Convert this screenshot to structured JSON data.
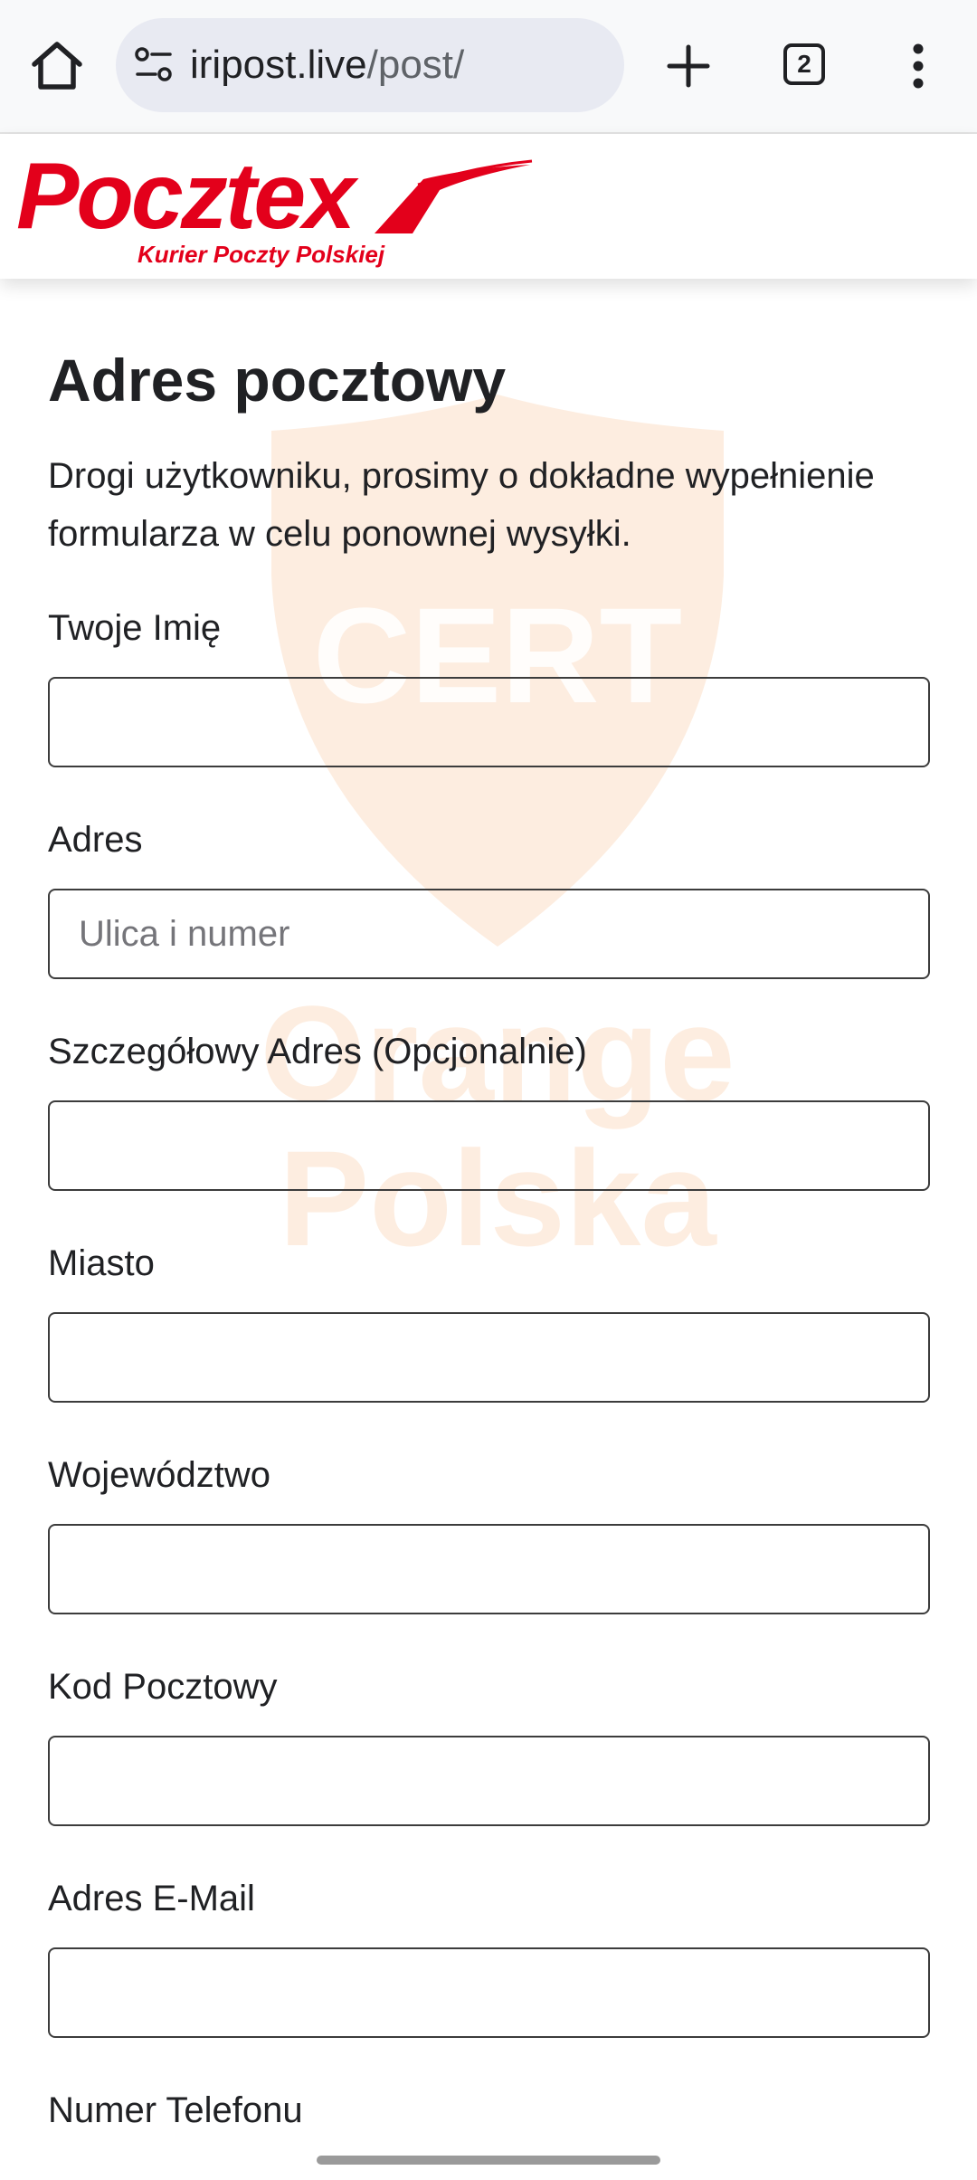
{
  "browser": {
    "url_host": "iripost.live",
    "url_path": "/post/",
    "tab_count": "2",
    "icons": [
      "home-icon",
      "site-info-icon",
      "plus-icon",
      "tabs-icon",
      "more-vert-icon"
    ]
  },
  "header": {
    "logo_text": "Pocztex",
    "logo_subtitle": "Kurier Poczty Polskiej",
    "brand_color": "#e3001b"
  },
  "watermark": {
    "line1": "CERT",
    "line2": "Orange",
    "line3": "Polska",
    "color": "#f47d20"
  },
  "form": {
    "title": "Adres pocztowy",
    "intro": "Drogi użytkowniku, prosimy o dokładne wypełnienie formularza w celu ponownej wysyłki.",
    "fields": [
      {
        "label": "Twoje Imię",
        "value": "",
        "placeholder": ""
      },
      {
        "label": "Adres",
        "value": "",
        "placeholder": "Ulica i numer"
      },
      {
        "label": "Szczegółowy Adres (Opcjonalnie)",
        "value": "",
        "placeholder": ""
      },
      {
        "label": "Miasto",
        "value": "",
        "placeholder": ""
      },
      {
        "label": "Województwo",
        "value": "",
        "placeholder": ""
      },
      {
        "label": "Kod Pocztowy",
        "value": "",
        "placeholder": ""
      },
      {
        "label": "Adres E-Mail",
        "value": "",
        "placeholder": ""
      },
      {
        "label": "Numer Telefonu",
        "value": "",
        "placeholder": ""
      }
    ]
  }
}
